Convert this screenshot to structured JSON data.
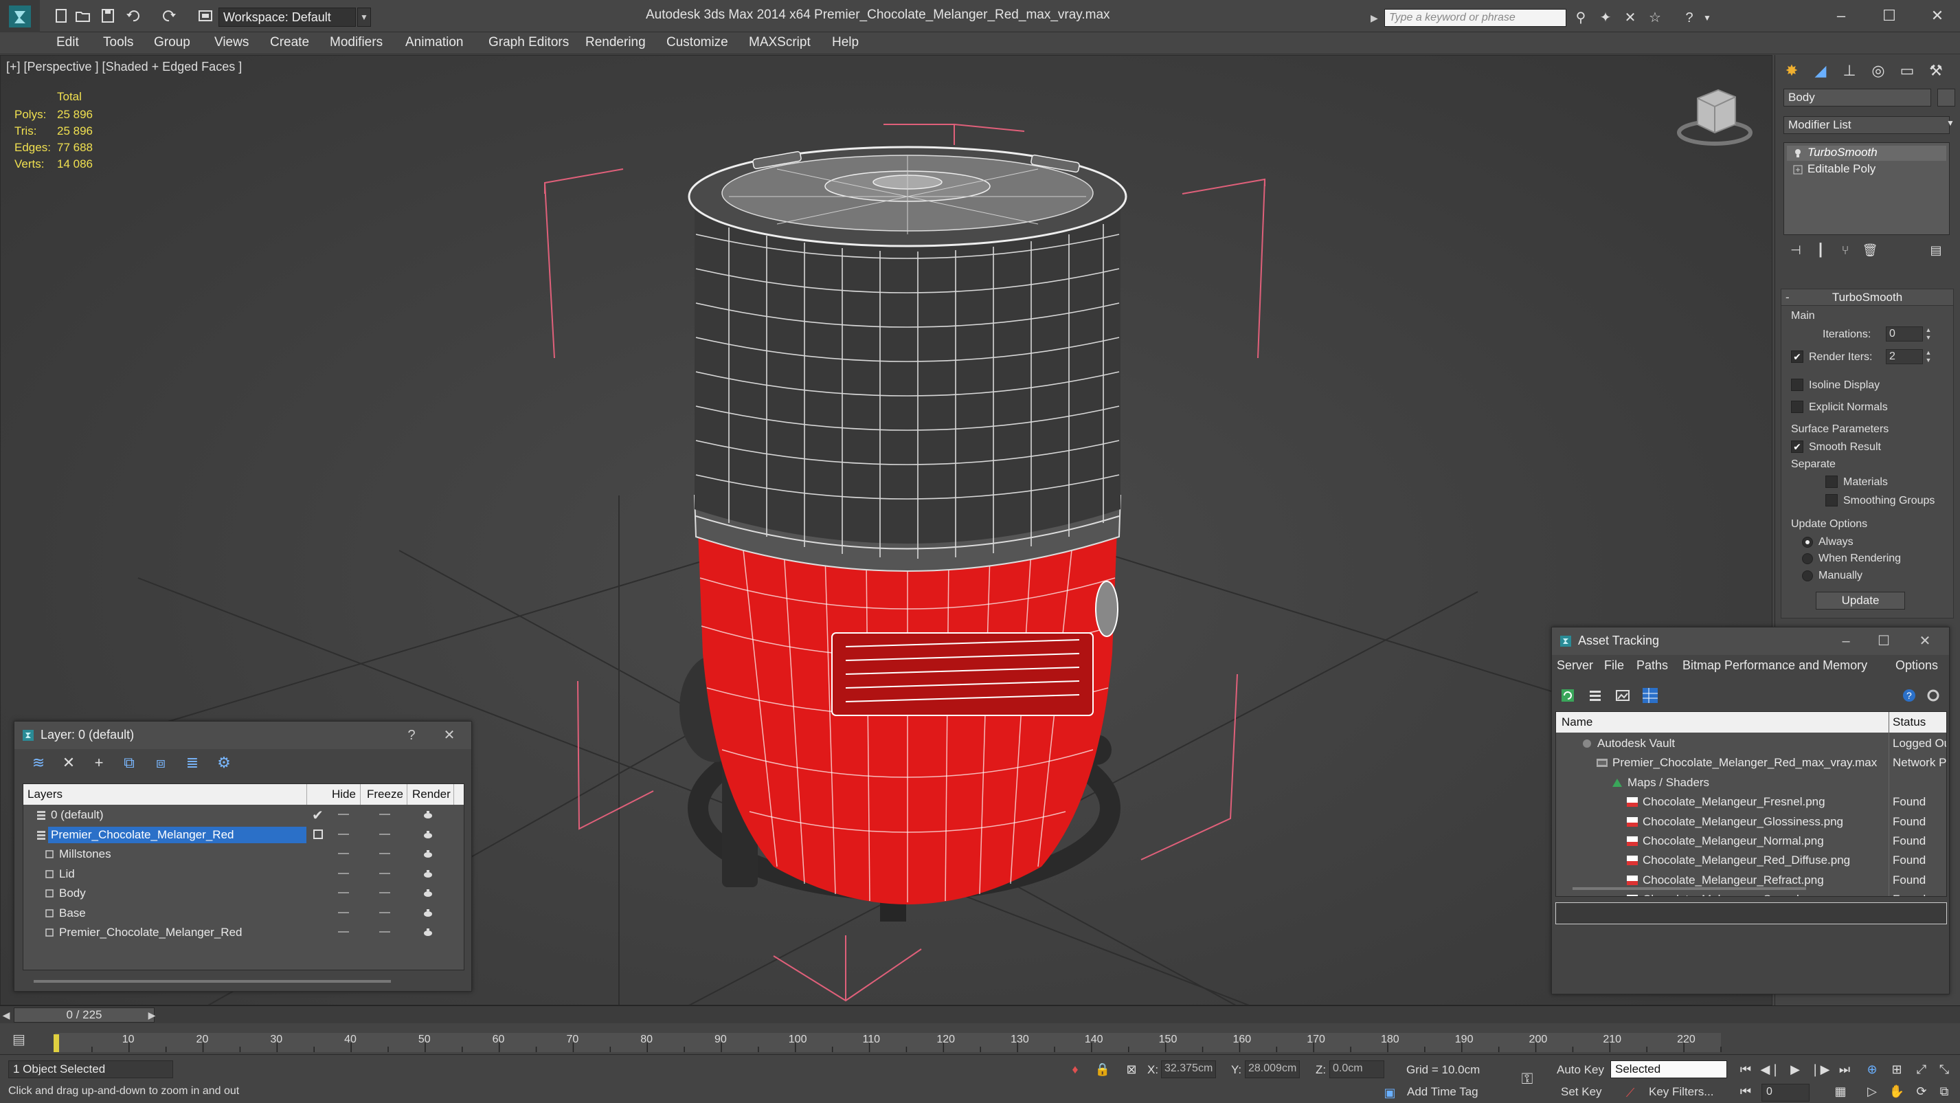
{
  "titlebar": {
    "workspace": "Workspace: Default",
    "app_title": "Autodesk 3ds Max  2014 x64      Premier_Chocolate_Melanger_Red_max_vray.max",
    "search_placeholder": "Type a keyword or phrase"
  },
  "menu": [
    "Edit",
    "Tools",
    "Group",
    "Views",
    "Create",
    "Modifiers",
    "Animation",
    "Graph Editors",
    "Rendering",
    "Customize",
    "MAXScript",
    "Help"
  ],
  "viewport": {
    "label": "[+] [Perspective ] [Shaded + Edged Faces ]",
    "stats_total_label": "Total",
    "stats": [
      {
        "label": "Polys:",
        "value": "25 896"
      },
      {
        "label": "Tris:",
        "value": "25 896"
      },
      {
        "label": "Edges:",
        "value": "77 688"
      },
      {
        "label": "Verts:",
        "value": "14 086"
      }
    ]
  },
  "command_panel": {
    "object_name": "Body",
    "modifier_list": "Modifier List",
    "stack": [
      "TurboSmooth",
      "Editable Poly"
    ],
    "rollout": {
      "title": "TurboSmooth",
      "main": "Main",
      "iterations_label": "Iterations:",
      "iterations_value": "0",
      "render_iters_label": "Render Iters:",
      "render_iters_value": "2",
      "isoline_display": "Isoline Display",
      "explicit_normals": "Explicit Normals",
      "surface_parameters": "Surface Parameters",
      "smooth_result": "Smooth Result",
      "separate": "Separate",
      "materials": "Materials",
      "smoothing_groups": "Smoothing Groups",
      "update_options": "Update Options",
      "always": "Always",
      "when_rendering": "When Rendering",
      "manually": "Manually",
      "update_button": "Update"
    }
  },
  "layer_dialog": {
    "title": "Layer: 0 (default)",
    "help": "?",
    "columns": [
      "Layers",
      "Hide",
      "Freeze",
      "Render"
    ],
    "rows": [
      {
        "name": "0 (default)",
        "indent": 0
      },
      {
        "name": "Premier_Chocolate_Melanger_Red",
        "indent": 0,
        "selected": true
      },
      {
        "name": "Millstones",
        "indent": 1
      },
      {
        "name": "Lid",
        "indent": 1
      },
      {
        "name": "Body",
        "indent": 1
      },
      {
        "name": "Base",
        "indent": 1
      },
      {
        "name": "Premier_Chocolate_Melanger_Red",
        "indent": 1
      }
    ]
  },
  "asset_tracking": {
    "title": "Asset Tracking",
    "menu": [
      "Server",
      "File",
      "Paths",
      "Bitmap Performance and Memory",
      "Options"
    ],
    "columns": [
      "Name",
      "Status"
    ],
    "rows": [
      {
        "name": "Autodesk Vault",
        "status": "Logged Ou",
        "indent": 1,
        "icon": "vault"
      },
      {
        "name": "Premier_Chocolate_Melanger_Red_max_vray.max",
        "status": "Network P",
        "indent": 2,
        "icon": "max"
      },
      {
        "name": "Maps / Shaders",
        "status": "",
        "indent": 3,
        "icon": "maps"
      },
      {
        "name": "Chocolate_Melangeur_Fresnel.png",
        "status": "Found",
        "indent": 4,
        "icon": "png"
      },
      {
        "name": "Chocolate_Melangeur_Glossiness.png",
        "status": "Found",
        "indent": 4,
        "icon": "png"
      },
      {
        "name": "Chocolate_Melangeur_Normal.png",
        "status": "Found",
        "indent": 4,
        "icon": "png"
      },
      {
        "name": "Chocolate_Melangeur_Red_Diffuse.png",
        "status": "Found",
        "indent": 4,
        "icon": "png"
      },
      {
        "name": "Chocolate_Melangeur_Refract.png",
        "status": "Found",
        "indent": 4,
        "icon": "png"
      },
      {
        "name": "Chocolate_Melangeur_Specular.png",
        "status": "Found",
        "indent": 4,
        "icon": "png"
      }
    ]
  },
  "timeline": {
    "frame_counter": "0 / 225",
    "ticks": [
      "10",
      "20",
      "30",
      "40",
      "50",
      "60",
      "70",
      "80",
      "90",
      "100",
      "110",
      "120",
      "130",
      "140",
      "150",
      "160",
      "170",
      "180",
      "190",
      "200",
      "210",
      "220"
    ]
  },
  "status": {
    "selection": "1 Object Selected",
    "prompt": "Click and drag up-and-down to zoom in and out",
    "x_label": "X:",
    "x_value": "32.375cm",
    "y_label": "Y:",
    "y_value": "28.009cm",
    "z_label": "Z:",
    "z_value": "0.0cm",
    "grid": "Grid = 10.0cm",
    "add_time_tag": "Add Time Tag",
    "auto_key": "Auto Key",
    "set_key": "Set Key",
    "selected_option": "Selected",
    "key_filters": "Key Filters...",
    "frame": "0"
  },
  "colors": {
    "accent_red": "#e01919",
    "selection_blue": "#2b70c8",
    "stats_yellow": "#f0e050",
    "bbox_pink": "#e0607a"
  }
}
